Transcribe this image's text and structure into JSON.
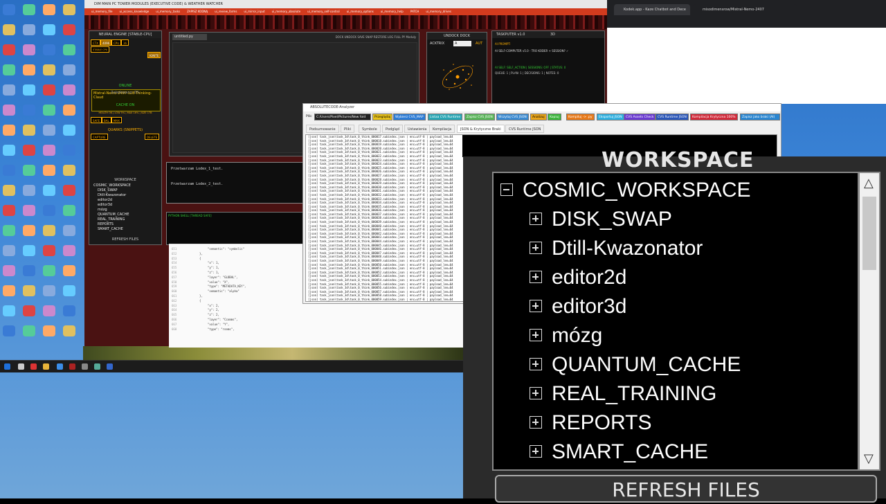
{
  "main_window": {
    "title": "DIM MAIN PC TOWER MODULES (EXECUTIVE CODE) & WEATHER WATCHER",
    "menu": [
      "ui_memory_file",
      "ui_access_knowledge",
      "ui_memory_tasks",
      "ZAPISZ KODNĄ",
      "ui_review_forms",
      "ui_mirror_input",
      "ui_memory_absolute",
      "ui_memory_self-control",
      "ui_memory_options",
      "ui_memory_help",
      "PATCH",
      "ui_memory_drives"
    ]
  },
  "neural": {
    "header": "NEURAL ENGINE [STABLE-CPU]",
    "ctx_label": "CTX",
    "ctx_value": "4096",
    "cpu_label": "CPU",
    "cpu_value": "16",
    "stable_chip": "STABLE CPU",
    "ignite": "IGNITE",
    "model": "Mistral-Nemo-2407-12B-Thinking-Claud",
    "status": "ONLINE",
    "loaded": "Załadowano: 0%",
    "cache_header": "CACHE ON",
    "cache_stats": "HEALTH OK | LOW 5% | MAX 16% | SIZE 1TB",
    "actions": [
      "SAFE",
      "BAL",
      "MAX"
    ],
    "quarks_header": "QUARKS (SNIPPETS)",
    "capture": "CAPTURE",
    "delete": "DELETE",
    "ws_header": "WORKSPACE",
    "ws_items": [
      "COSMIC_WORKSPACE",
      "DISK_SWAP",
      "Dtill-Kwazonator",
      "editor2d",
      "editor3d",
      "mózg",
      "QUANTUM_CACHE",
      "REAL_TRAINING",
      "REPORTS",
      "SMART_CACHE"
    ],
    "refresh": "REFRESH FILES"
  },
  "editor": {
    "tab": "untitled.py",
    "toolbar": "DOCK  UNDOCK  SAVE  SNAP  RESTORE  LOG  FULL  PY Moduły"
  },
  "output": {
    "line1": "Przetwarzam Lodex_1_test.",
    "line2": "Przetwarzam Lodex_2_test."
  },
  "shell": {
    "label": "PYTHON SHELL [THREAD SAFE]"
  },
  "undock": {
    "header": "UNDOCK DOCK",
    "checkbox": "ACKTRIX",
    "select": "A",
    "auto": "AUT"
  },
  "taskputer": {
    "header": "TASKPUTER v1.0",
    "mode": "3D",
    "line1": "AI PROMPT:",
    "line2": "AI SELF-COMPUTER v5.0 - TRO KODER + SESSION? ✓",
    "line3": "AI SELF: SELF_ACTION | SESSIONS: OFF | STATUS: 0",
    "line4": "QUEUE: 1 | PLAN: 1 | DECISIONS: 1 | NOTES: 0"
  },
  "browser": {
    "tab1": "Kodek.app - Kaze Chatbot and Dece",
    "tab2": "misodimensrow/Mistral-Nemo-2407"
  },
  "analyzer": {
    "title": "ABSOLUTECODE-Analyzer",
    "file_label": "Plik:",
    "path": "C:/Users/Pixel/Pictures/New fold",
    "buttons": [
      "Przeglądaj",
      "Wybierz CVS_MAP",
      "Listaa CVS Runtime",
      "Zapisz CVS JSON",
      "Wczytaj CVS JSON",
      "Analizuj",
      "Kopiuj",
      "Kompiluj -> .py",
      "Eksportuj JSON",
      "CVS Assets Check",
      "CVS Runtime JSON",
      "Kompilacja Krytyczna 100%",
      "Zapisz jako braki (AI)"
    ],
    "tabs": [
      "Podsumowanie",
      "Pliki",
      "Symbole",
      "Podgląd",
      "Ustawienia",
      "Kompilacja",
      "JSON & Krytyczne Braki",
      "CVS Runtime JSON"
    ],
    "log_prefix": "[json] task_json\\task_3d\\task_0_think_",
    "log_suffix": ".subindex.json | enc=utf-8 | payload_len=64"
  },
  "zoom": {
    "header": "WORKSPACE",
    "root": "COSMIC_WORKSPACE",
    "items": [
      "DISK_SWAP",
      "Dtill-Kwazonator",
      "editor2d",
      "editor3d",
      "mózg",
      "QUANTUM_CACHE",
      "REAL_TRAINING",
      "REPORTS",
      "SMART_CACHE"
    ],
    "refresh": "REFRESH FILES"
  },
  "code": {
    "lines": [
      "\"semantic\": \"symbolic\"",
      "},",
      "{",
      "\"x\": 1,",
      "\"y\": 1,",
      "\"z\": 1,",
      "\"layer\": \"GLOBAL\",",
      "\"value\": \"X\",",
      "\"type\": \"METADATA_KEY\",",
      "\"semantic\": \"alpha\"",
      "},",
      "{",
      "\"x\": 2,",
      "\"y\": 2,",
      "\"z\": 2,",
      "\"layer\": \"Ccomms\",",
      "\"value\": \"Y\",",
      "\"type\": \"rooms\","
    ]
  }
}
